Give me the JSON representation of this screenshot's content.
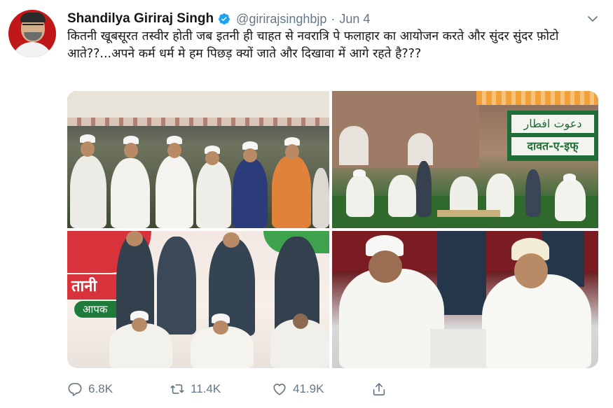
{
  "author": {
    "name": "Shandilya Giriraj Singh",
    "handle": "@girirajsinghbjp",
    "separator": "·",
    "date": "Jun 4",
    "verified": true
  },
  "tweet": {
    "text": "कितनी खूबसूरत तस्वीर होती जब इतनी ही चाहत से नवरात्रि पे फलाहार का आयोजन करते और सुंदर सुंदर फ़ोटो आते??...अपने कर्म धर्म मे हम पिछड़ क्यों जाते और दिखावा में आगे रहते है???"
  },
  "media": {
    "photo_count": 4,
    "banner_text": {
      "top_right_urdu": "دعوت افطار",
      "top_right_hindi": "दावत-ए-इफ्",
      "bottom_left_fragment": "तानी",
      "bottom_left_pill": "आपक"
    }
  },
  "stats": {
    "replies": "6.8K",
    "retweets": "11.4K",
    "likes": "41.9K"
  },
  "icons": {
    "verified": "verified-badge-icon",
    "chevron": "chevron-down-icon",
    "reply": "reply-icon",
    "retweet": "retweet-icon",
    "like": "heart-icon",
    "share": "share-icon"
  },
  "colors": {
    "verified": "#1da1f2",
    "muted": "#657786",
    "text": "#14171a",
    "avatar_bg": "#c01818"
  }
}
